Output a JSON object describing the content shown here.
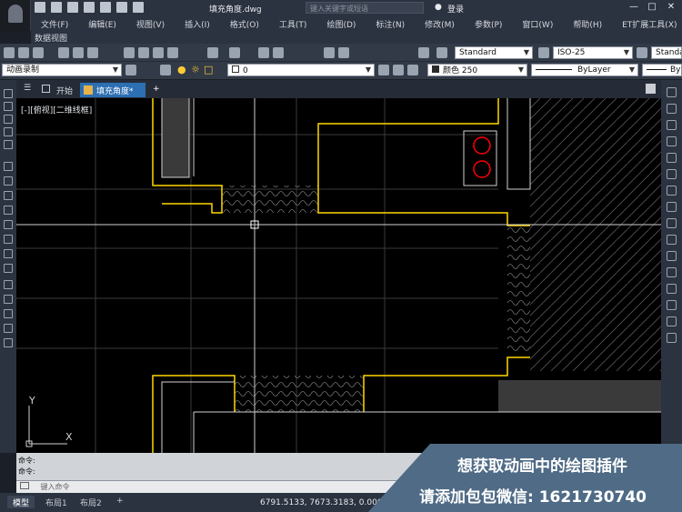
{
  "title_bar": {
    "document": "填充角度.dwg",
    "search_placeholder": "键入关键字或短语",
    "login": "登录"
  },
  "menu": [
    "文件(F)",
    "编辑(E)",
    "视图(V)",
    "插入(I)",
    "格式(O)",
    "工具(T)",
    "绘图(D)",
    "标注(N)",
    "修改(M)",
    "参数(P)",
    "窗口(W)",
    "帮助(H)",
    "ET扩展工具(X)"
  ],
  "submenu": "数据视图",
  "toolbar": {
    "text_style": "Standard",
    "dim_style": "ISO-25",
    "table_style": "Standa",
    "workspace": "动画录制",
    "layer": "0",
    "color": "颜色 250",
    "linetype": "ByLayer",
    "lineweight": "By"
  },
  "tabs": {
    "start": "开始",
    "active": "填充角度*",
    "add": "+"
  },
  "viewport_label": "[-][俯视][二维线框]",
  "ucs": {
    "y": "Y",
    "x": "X"
  },
  "command": {
    "line1": "命令:",
    "line2": "命令:",
    "input_placeholder": "键入命令"
  },
  "layout_tabs": [
    "模型",
    "布局1",
    "布局2",
    "+"
  ],
  "coords": "6791.5133, 7673.3183, 0.0000",
  "promo": {
    "line1": "想获取动画中的绘图插件",
    "line2": "请添加包包微信: 1621730740"
  },
  "colors": {
    "hatch_outline": "#ffd700",
    "circles": "#ff0000",
    "accent": "#2c6fb3"
  }
}
